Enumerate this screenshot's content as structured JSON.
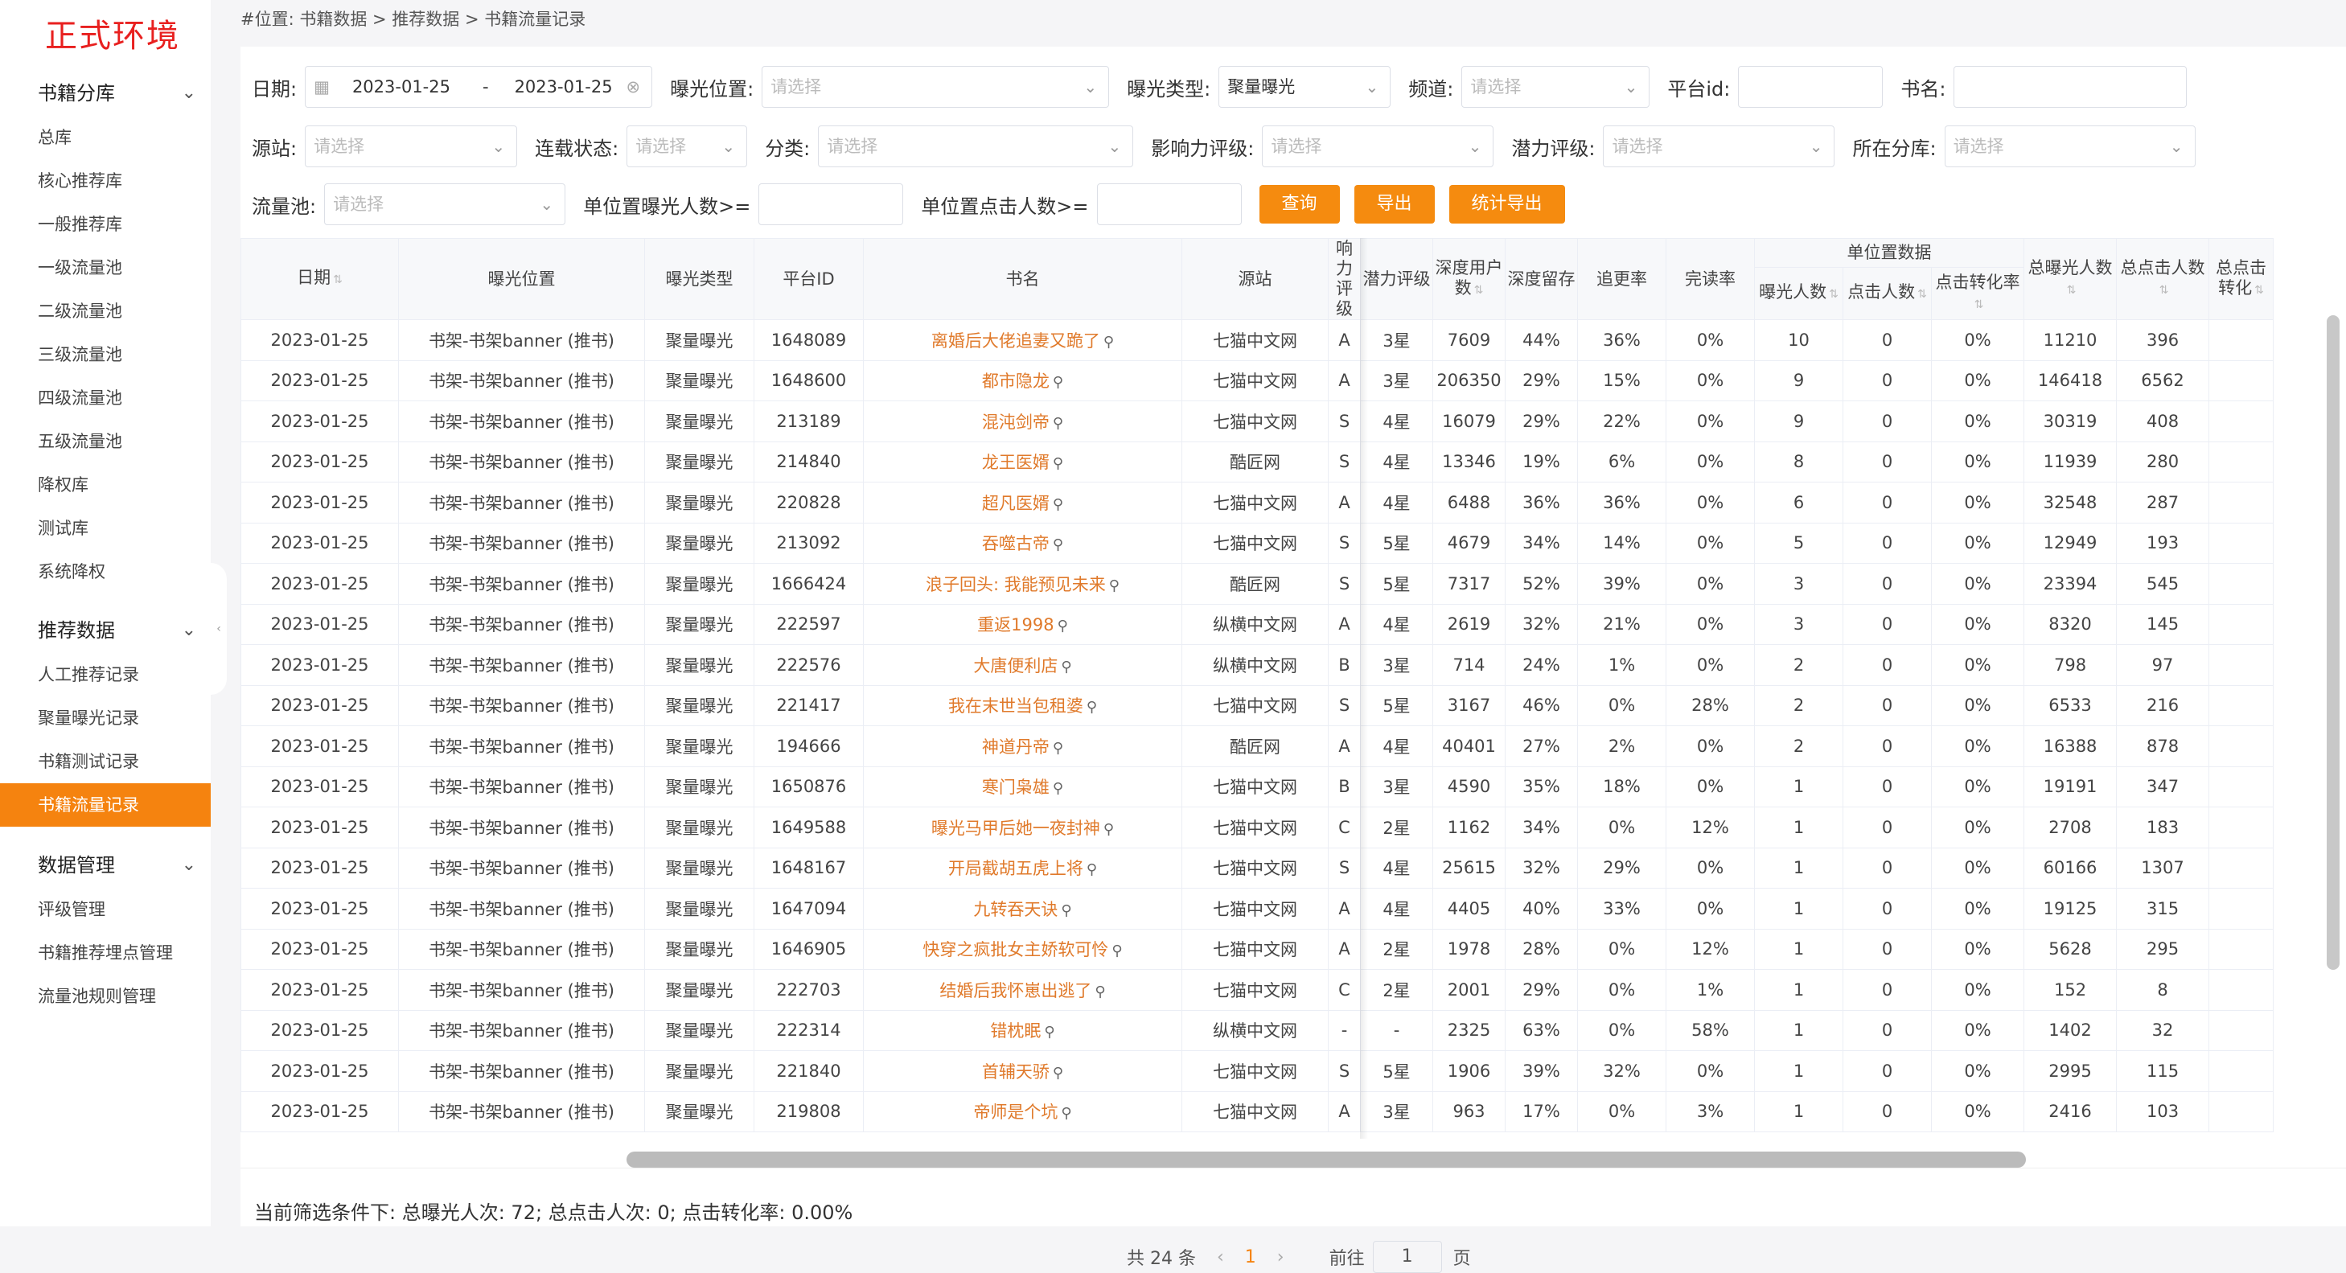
{
  "app": {
    "env_label": "正式环境"
  },
  "sidebar": {
    "groups": [
      {
        "title": "书籍分库",
        "items": [
          "总库",
          "核心推荐库",
          "一般推荐库",
          "一级流量池",
          "二级流量池",
          "三级流量池",
          "四级流量池",
          "五级流量池",
          "降权库",
          "测试库",
          "系统降权"
        ]
      },
      {
        "title": "推荐数据",
        "items": [
          "人工推荐记录",
          "聚量曝光记录",
          "书籍测试记录",
          "书籍流量记录"
        ]
      },
      {
        "title": "数据管理",
        "items": [
          "评级管理",
          "书籍推荐埋点管理",
          "流量池规则管理"
        ]
      }
    ],
    "active_item": "书籍流量记录"
  },
  "breadcrumb": "#位置:  书籍数据 > 推荐数据 > 书籍流量记录",
  "filters": {
    "date_label": "日期:",
    "date_start": "2023-01-25",
    "date_sep": "-",
    "date_end": "2023-01-25",
    "position_label": "曝光位置:",
    "position_placeholder": "请选择",
    "type_label": "曝光类型:",
    "type_value": "聚量曝光",
    "channel_label": "频道:",
    "channel_placeholder": "请选择",
    "platform_label": "平台id:",
    "bookname_label": "书名:",
    "source_label": "源站:",
    "source_placeholder": "请选择",
    "serial_label": "连载状态:",
    "serial_placeholder": "请选择",
    "category_label": "分类:",
    "category_placeholder": "请选择",
    "influence_label": "影响力评级:",
    "influence_placeholder": "请选择",
    "potential_label": "潜力评级:",
    "potential_placeholder": "请选择",
    "library_label": "所在分库:",
    "library_placeholder": "请选择",
    "pool_label": "流量池:",
    "pool_placeholder": "请选择",
    "unit_exposure_label": "单位置曝光人数>=",
    "unit_click_label": "单位置点击人数>=",
    "query_button": "查询",
    "export_button": "导出",
    "stats_export_button": "统计导出"
  },
  "table": {
    "group_header": "单位置数据",
    "headers": [
      "日期",
      "曝光位置",
      "曝光类型",
      "平台ID",
      "书名",
      "源站",
      "响力评级",
      "潜力评级",
      "深度用户数",
      "深度留存",
      "追更率",
      "完读率",
      "曝光人数",
      "点击人数",
      "点击转化率",
      "总曝光人数",
      "总点击人数",
      "总点击转化"
    ],
    "rows": [
      [
        "2023-01-25",
        "书架-书架banner (推书)",
        "聚量曝光",
        "1648089",
        "离婚后大佬追妻又跪了",
        "七猫中文网",
        "A",
        "3星",
        "7609",
        "44%",
        "36%",
        "0%",
        "10",
        "0",
        "0%",
        "11210",
        "396",
        ""
      ],
      [
        "2023-01-25",
        "书架-书架banner (推书)",
        "聚量曝光",
        "1648600",
        "都市隐龙",
        "七猫中文网",
        "A",
        "3星",
        "206350",
        "29%",
        "15%",
        "0%",
        "9",
        "0",
        "0%",
        "146418",
        "6562",
        ""
      ],
      [
        "2023-01-25",
        "书架-书架banner (推书)",
        "聚量曝光",
        "213189",
        "混沌剑帝",
        "七猫中文网",
        "S",
        "4星",
        "16079",
        "29%",
        "22%",
        "0%",
        "9",
        "0",
        "0%",
        "30319",
        "408",
        ""
      ],
      [
        "2023-01-25",
        "书架-书架banner (推书)",
        "聚量曝光",
        "214840",
        "龙王医婿",
        "酷匠网",
        "S",
        "4星",
        "13346",
        "19%",
        "6%",
        "0%",
        "8",
        "0",
        "0%",
        "11939",
        "280",
        ""
      ],
      [
        "2023-01-25",
        "书架-书架banner (推书)",
        "聚量曝光",
        "220828",
        "超凡医婿",
        "七猫中文网",
        "A",
        "4星",
        "6488",
        "36%",
        "36%",
        "0%",
        "6",
        "0",
        "0%",
        "32548",
        "287",
        ""
      ],
      [
        "2023-01-25",
        "书架-书架banner (推书)",
        "聚量曝光",
        "213092",
        "吞噬古帝",
        "七猫中文网",
        "S",
        "5星",
        "4679",
        "34%",
        "14%",
        "0%",
        "5",
        "0",
        "0%",
        "12949",
        "193",
        ""
      ],
      [
        "2023-01-25",
        "书架-书架banner (推书)",
        "聚量曝光",
        "1666424",
        "浪子回头: 我能预见未来",
        "酷匠网",
        "S",
        "5星",
        "7317",
        "52%",
        "39%",
        "0%",
        "3",
        "0",
        "0%",
        "23394",
        "545",
        ""
      ],
      [
        "2023-01-25",
        "书架-书架banner (推书)",
        "聚量曝光",
        "222597",
        "重返1998",
        "纵横中文网",
        "A",
        "4星",
        "2619",
        "32%",
        "21%",
        "0%",
        "3",
        "0",
        "0%",
        "8320",
        "145",
        ""
      ],
      [
        "2023-01-25",
        "书架-书架banner (推书)",
        "聚量曝光",
        "222576",
        "大唐便利店",
        "纵横中文网",
        "B",
        "3星",
        "714",
        "24%",
        "1%",
        "0%",
        "2",
        "0",
        "0%",
        "798",
        "97",
        ""
      ],
      [
        "2023-01-25",
        "书架-书架banner (推书)",
        "聚量曝光",
        "221417",
        "我在末世当包租婆",
        "七猫中文网",
        "S",
        "5星",
        "3167",
        "46%",
        "0%",
        "28%",
        "2",
        "0",
        "0%",
        "6533",
        "216",
        ""
      ],
      [
        "2023-01-25",
        "书架-书架banner (推书)",
        "聚量曝光",
        "194666",
        "神道丹帝",
        "酷匠网",
        "A",
        "4星",
        "40401",
        "27%",
        "2%",
        "0%",
        "2",
        "0",
        "0%",
        "16388",
        "878",
        ""
      ],
      [
        "2023-01-25",
        "书架-书架banner (推书)",
        "聚量曝光",
        "1650876",
        "寒门枭雄",
        "七猫中文网",
        "B",
        "3星",
        "4590",
        "35%",
        "18%",
        "0%",
        "1",
        "0",
        "0%",
        "19191",
        "347",
        ""
      ],
      [
        "2023-01-25",
        "书架-书架banner (推书)",
        "聚量曝光",
        "1649588",
        "曝光马甲后她一夜封神",
        "七猫中文网",
        "C",
        "2星",
        "1162",
        "34%",
        "0%",
        "12%",
        "1",
        "0",
        "0%",
        "2708",
        "183",
        ""
      ],
      [
        "2023-01-25",
        "书架-书架banner (推书)",
        "聚量曝光",
        "1648167",
        "开局截胡五虎上将",
        "七猫中文网",
        "S",
        "4星",
        "25615",
        "32%",
        "29%",
        "0%",
        "1",
        "0",
        "0%",
        "60166",
        "1307",
        ""
      ],
      [
        "2023-01-25",
        "书架-书架banner (推书)",
        "聚量曝光",
        "1647094",
        "九转吞天诀",
        "七猫中文网",
        "A",
        "4星",
        "4405",
        "40%",
        "33%",
        "0%",
        "1",
        "0",
        "0%",
        "19125",
        "315",
        ""
      ],
      [
        "2023-01-25",
        "书架-书架banner (推书)",
        "聚量曝光",
        "1646905",
        "快穿之疯批女主娇软可怜",
        "七猫中文网",
        "A",
        "2星",
        "1978",
        "28%",
        "0%",
        "12%",
        "1",
        "0",
        "0%",
        "5628",
        "295",
        ""
      ],
      [
        "2023-01-25",
        "书架-书架banner (推书)",
        "聚量曝光",
        "222703",
        "结婚后我怀崽出逃了",
        "七猫中文网",
        "C",
        "2星",
        "2001",
        "29%",
        "0%",
        "1%",
        "1",
        "0",
        "0%",
        "152",
        "8",
        ""
      ],
      [
        "2023-01-25",
        "书架-书架banner (推书)",
        "聚量曝光",
        "222314",
        "错枕眠",
        "纵横中文网",
        "-",
        "-",
        "2325",
        "63%",
        "0%",
        "58%",
        "1",
        "0",
        "0%",
        "1402",
        "32",
        ""
      ],
      [
        "2023-01-25",
        "书架-书架banner (推书)",
        "聚量曝光",
        "221840",
        "首辅天骄",
        "七猫中文网",
        "S",
        "5星",
        "1906",
        "39%",
        "32%",
        "0%",
        "1",
        "0",
        "0%",
        "2995",
        "115",
        ""
      ],
      [
        "2023-01-25",
        "书架-书架banner (推书)",
        "聚量曝光",
        "219808",
        "帝师是个坑",
        "七猫中文网",
        "A",
        "3星",
        "963",
        "17%",
        "0%",
        "3%",
        "1",
        "0",
        "0%",
        "2416",
        "103",
        ""
      ]
    ]
  },
  "summary": "当前筛选条件下:  总曝光人次: 72; 总点击人次: 0; 点击转化率: 0.00%",
  "pagination": {
    "total": "共 24 条",
    "prev": "‹",
    "current": "1",
    "next": "›",
    "goto_label": "前往",
    "goto_value": "1",
    "page_suffix": "页"
  },
  "colors": {
    "accent": "#f5830f",
    "env": "#e8201f",
    "book_link": "#e07a2b"
  }
}
